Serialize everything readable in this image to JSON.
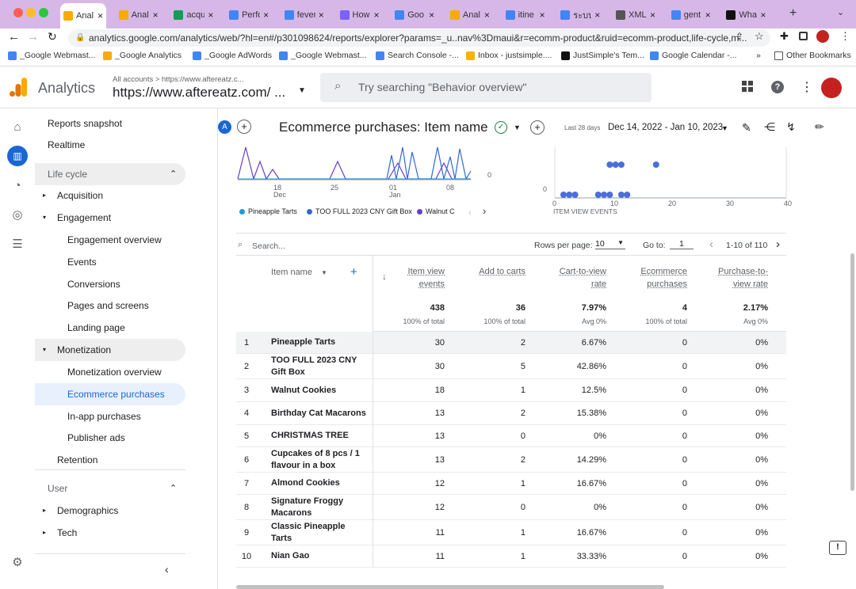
{
  "browser": {
    "tabs": [
      {
        "label": "Anal",
        "color": "#f9ab00"
      },
      {
        "label": "Anal",
        "color": "#f9ab00"
      },
      {
        "label": "acqu",
        "color": "#0f9d58"
      },
      {
        "label": "Perfo",
        "color": "#4285f4"
      },
      {
        "label": "fever",
        "color": "#4285f4"
      },
      {
        "label": "How",
        "color": "#7b61ff"
      },
      {
        "label": "Goo",
        "color": "#4285f4"
      },
      {
        "label": "Anal",
        "color": "#f9ab00"
      },
      {
        "label": "itine",
        "color": "#4285f4"
      },
      {
        "label": "ระบบ",
        "color": "#4285f4"
      },
      {
        "label": "XML",
        "color": "#555"
      },
      {
        "label": "gent",
        "color": "#4285f4"
      },
      {
        "label": "Wha",
        "color": "#111"
      }
    ],
    "url": "analytics.google.com/analytics/web/?hl=en#/p301098624/reports/explorer?params=_u..nav%3Dmaui&r=ecomm-product&ruid=ecomm-product,life-cycle,m...",
    "bookmarks": [
      {
        "label": "_Google Webmast...",
        "color": "#4285f4"
      },
      {
        "label": "_Google Analytics",
        "color": "#f9ab00"
      },
      {
        "label": "_Google AdWords",
        "color": "#4285f4"
      },
      {
        "label": "_Google Webmast...",
        "color": "#4285f4"
      },
      {
        "label": "Search Console -...",
        "color": "#4285f4"
      },
      {
        "label": "Inbox - justsimple....",
        "color": "#f4b400"
      },
      {
        "label": "JustSimple's Tem...",
        "color": "#111"
      },
      {
        "label": "Google Calendar -...",
        "color": "#4285f4"
      }
    ],
    "more_bookmarks": "»",
    "other_bookmarks": "Other Bookmarks"
  },
  "header": {
    "app_name": "Analytics",
    "breadcrumb": "All accounts > https://www.aftereatz.c...",
    "property": "https://www.aftereatz.com/ ...",
    "search_placeholder": "Try searching \"Behavior overview\""
  },
  "sidenav": {
    "reports_snapshot": "Reports snapshot",
    "realtime": "Realtime",
    "life_cycle": "Life cycle",
    "acquisition": "Acquisition",
    "engagement": "Engagement",
    "engagement_items": [
      "Engagement overview",
      "Events",
      "Conversions",
      "Pages and screens",
      "Landing page"
    ],
    "monetization": "Monetization",
    "monetization_items": [
      "Monetization overview",
      "Ecommerce purchases",
      "In-app purchases",
      "Publisher ads"
    ],
    "retention": "Retention",
    "user": "User",
    "demographics": "Demographics",
    "tech": "Tech"
  },
  "report": {
    "avatar": "A",
    "title": "Ecommerce purchases: Item name",
    "date_label": "Last 28 days",
    "date_range": "Dec 14, 2022 - Jan 10, 2023"
  },
  "line_chart": {
    "x_ticks": [
      {
        "t": "18",
        "s": "Dec"
      },
      {
        "t": "25",
        "s": ""
      },
      {
        "t": "01",
        "s": "Jan"
      },
      {
        "t": "08",
        "s": ""
      }
    ],
    "y_zero": "0",
    "legend": [
      {
        "name": "Pineapple Tarts",
        "color": "#1a9bd7"
      },
      {
        "name": "TOO FULL 2023 CNY Gift Box",
        "color": "#3367d6"
      },
      {
        "name": "Walnut C",
        "color": "#6a3ec7"
      }
    ]
  },
  "chart_data": {
    "type": "scatter",
    "xlabel": "ITEM VIEW EVENTS",
    "x_ticks": [
      "0",
      "10",
      "20",
      "30",
      "40"
    ],
    "y_ticks": [
      "0"
    ],
    "xlim": [
      0,
      40
    ],
    "points": [
      {
        "x": 1.5,
        "y": 0
      },
      {
        "x": 2.5,
        "y": 0
      },
      {
        "x": 3.5,
        "y": 0
      },
      {
        "x": 7.5,
        "y": 0
      },
      {
        "x": 8.5,
        "y": 0
      },
      {
        "x": 9.5,
        "y": 0
      },
      {
        "x": 11.5,
        "y": 0
      },
      {
        "x": 12.5,
        "y": 0
      },
      {
        "x": 9.5,
        "y": 1
      },
      {
        "x": 10.5,
        "y": 1
      },
      {
        "x": 11.5,
        "y": 1
      },
      {
        "x": 17.5,
        "y": 1
      }
    ]
  },
  "table": {
    "search_placeholder": "Search...",
    "rows_per_page_label": "Rows per page:",
    "rows_per_page": "10",
    "goto_label": "Go to:",
    "goto_value": "1",
    "page_info": "1-10 of 110",
    "dimension": "Item name",
    "columns": [
      {
        "label": "Item view events",
        "total": "438",
        "sub": "100% of total"
      },
      {
        "label": "Add to carts",
        "total": "36",
        "sub": "100% of total"
      },
      {
        "label": "Cart-to-view rate",
        "total": "7.97%",
        "sub": "Avg 0%"
      },
      {
        "label": "Ecommerce purchases",
        "total": "4",
        "sub": "100% of total"
      },
      {
        "label": "Purchase-to-view rate",
        "total": "2.17%",
        "sub": "Avg 0%"
      }
    ],
    "rows": [
      {
        "i": "1",
        "name": "Pineapple Tarts",
        "v": [
          "30",
          "2",
          "6.67%",
          "0",
          "0%"
        ]
      },
      {
        "i": "2",
        "name": "TOO FULL 2023 CNY Gift Box",
        "v": [
          "30",
          "5",
          "42.86%",
          "0",
          "0%"
        ]
      },
      {
        "i": "3",
        "name": "Walnut Cookies",
        "v": [
          "18",
          "1",
          "12.5%",
          "0",
          "0%"
        ]
      },
      {
        "i": "4",
        "name": "Birthday Cat Macarons",
        "v": [
          "13",
          "2",
          "15.38%",
          "0",
          "0%"
        ]
      },
      {
        "i": "5",
        "name": "CHRISTMAS TREE",
        "v": [
          "13",
          "0",
          "0%",
          "0",
          "0%"
        ]
      },
      {
        "i": "6",
        "name": "Cupcakes of 8 pcs / 1 flavour in a box",
        "v": [
          "13",
          "2",
          "14.29%",
          "0",
          "0%"
        ]
      },
      {
        "i": "7",
        "name": "Almond Cookies",
        "v": [
          "12",
          "1",
          "16.67%",
          "0",
          "0%"
        ]
      },
      {
        "i": "8",
        "name": "Signature Froggy Macarons",
        "v": [
          "12",
          "0",
          "0%",
          "0",
          "0%"
        ]
      },
      {
        "i": "9",
        "name": "Classic Pineapple Tarts",
        "v": [
          "11",
          "1",
          "16.67%",
          "0",
          "0%"
        ]
      },
      {
        "i": "10",
        "name": "Nian Gao",
        "v": [
          "11",
          "1",
          "33.33%",
          "0",
          "0%"
        ]
      }
    ]
  },
  "colors": {
    "accent": "#1967d2",
    "selected_bg": "#e8f0fe"
  }
}
